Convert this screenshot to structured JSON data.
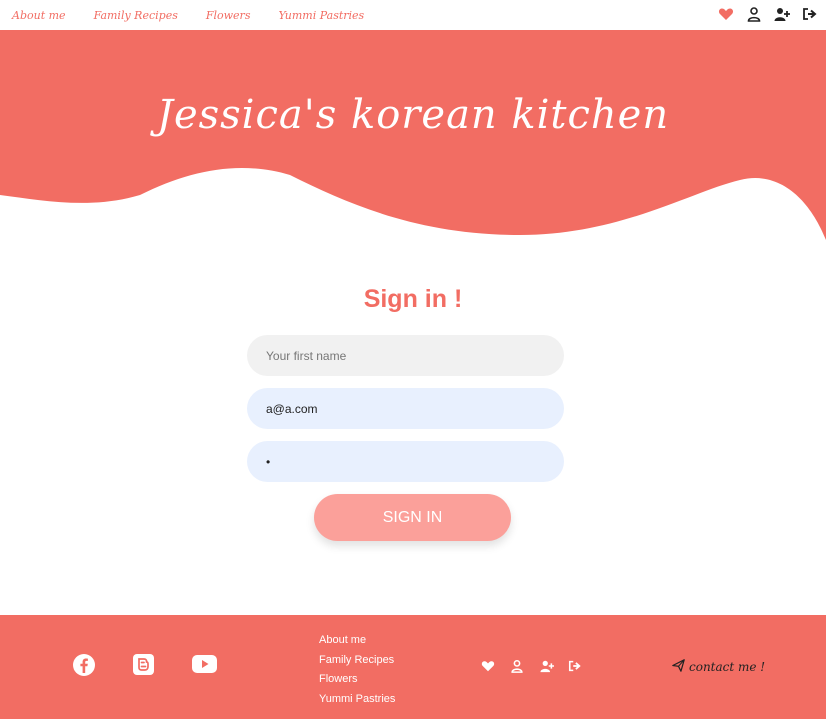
{
  "nav": {
    "links": [
      "About me",
      "Family Recipes",
      "Flowers",
      "Yummi Pastries"
    ],
    "icons": [
      "heart-icon",
      "user-icon",
      "user-plus-icon",
      "logout-icon"
    ]
  },
  "hero": {
    "title": "Jessica's korean kitchen"
  },
  "form": {
    "title": "Sign in !",
    "name_placeholder": "Your first name",
    "email_value": "a@a.com",
    "password_value": "•",
    "submit_label": "SIGN IN"
  },
  "footer": {
    "social_icons": [
      "facebook-icon",
      "blogger-icon",
      "youtube-icon"
    ],
    "links": [
      "About me",
      "Family Recipes",
      "Flowers",
      "Yummi Pastries"
    ],
    "icons": [
      "heart-icon",
      "user-icon",
      "user-plus-icon",
      "logout-icon"
    ],
    "contact_label": "contact me !"
  },
  "colors": {
    "brand": "#f26d63",
    "button": "#fba09a",
    "autofill": "#e8f0fe",
    "field": "#f1f1f1"
  }
}
